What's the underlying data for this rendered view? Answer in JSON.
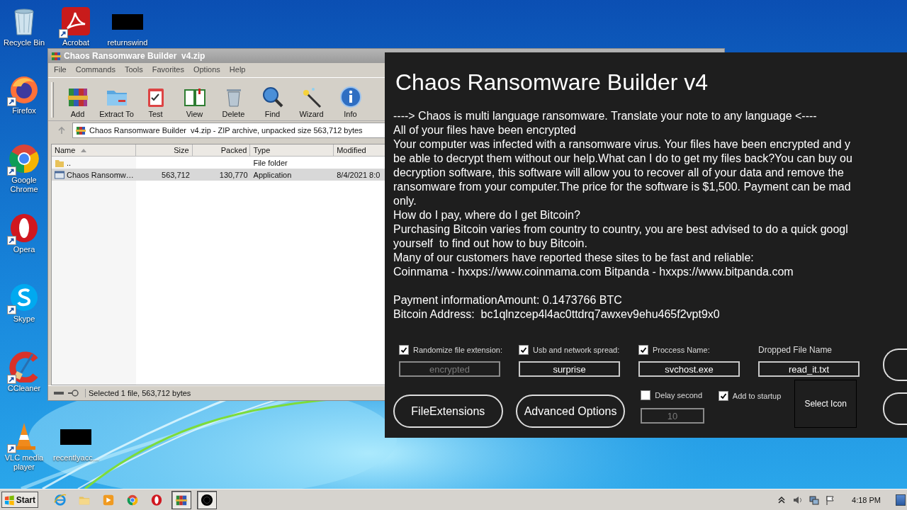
{
  "desktop": {
    "icons": [
      {
        "label": "Recycle Bin",
        "kind": "recycle",
        "shortcut": false
      },
      {
        "label": "Acrobat",
        "kind": "acrobat",
        "shortcut": true
      },
      {
        "label": "returnswind",
        "kind": "redacted",
        "shortcut": false
      },
      {
        "label": "Firefox",
        "kind": "firefox",
        "shortcut": true
      },
      {
        "label": "Google Chrome",
        "kind": "chrome",
        "shortcut": true
      },
      {
        "label": "Opera",
        "kind": "opera",
        "shortcut": true
      },
      {
        "label": "Skype",
        "kind": "skype",
        "shortcut": true
      },
      {
        "label": "CCleaner",
        "kind": "ccleaner",
        "shortcut": true
      },
      {
        "label": "VLC media player",
        "kind": "vlc",
        "shortcut": true
      },
      {
        "label": "recentlyacc...",
        "kind": "redacted",
        "shortcut": false
      }
    ]
  },
  "archive_window": {
    "title": "Chaos Ransomware Builder  v4.zip",
    "menu": [
      "File",
      "Commands",
      "Tools",
      "Favorites",
      "Options",
      "Help"
    ],
    "toolbar": [
      {
        "label": "Add",
        "kind": "add"
      },
      {
        "label": "Extract To",
        "kind": "extract"
      },
      {
        "label": "Test",
        "kind": "test"
      },
      {
        "label": "View",
        "kind": "view"
      },
      {
        "label": "Delete",
        "kind": "delete"
      },
      {
        "label": "Find",
        "kind": "find"
      },
      {
        "label": "Wizard",
        "kind": "wizard"
      },
      {
        "label": "Info",
        "kind": "info"
      }
    ],
    "path": "Chaos Ransomware Builder  v4.zip - ZIP archive, unpacked size 563,712 bytes",
    "columns": [
      {
        "label": "Name",
        "sorted": true
      },
      {
        "label": "Size",
        "sorted": false
      },
      {
        "label": "Packed",
        "sorted": false
      },
      {
        "label": "Type",
        "sorted": false
      },
      {
        "label": "Modified",
        "sorted": false
      }
    ],
    "rows": [
      {
        "kind": "folder",
        "name": "..",
        "type": "File folder",
        "selected": false
      },
      {
        "kind": "app",
        "name": "Chaos Ransomw…",
        "size": "563,712",
        "packed": "130,770",
        "type": "Application",
        "modified": "8/4/2021 8:0",
        "selected": true
      }
    ],
    "status": "Selected 1 file, 563,712 bytes"
  },
  "builder_window": {
    "title": "Chaos Ransomware Builder v4",
    "note_lines": [
      "----> Chaos is multi language ransomware. Translate your note to any language <----",
      "All of your files have been encrypted",
      "Your computer was infected with a ransomware virus. Your files have been encrypted and y",
      "be able to decrypt them without our help.What can I do to get my files back?You can buy ou",
      "decryption software, this software will allow you to recover all of your data and remove the",
      "ransomware from your computer.The price for the software is $1,500. Payment can be mad",
      "only.",
      "How do I pay, where do I get Bitcoin?",
      "Purchasing Bitcoin varies from country to country, you are best advised to do a quick googl",
      "yourself  to find out how to buy Bitcoin.",
      "Many of our customers have reported these sites to be fast and reliable:",
      "Coinmama - hxxps://www.coinmama.com Bitpanda - hxxps://www.bitpanda.com"
    ],
    "payment_lines": [
      "Payment informationAmount: 0.1473766 BTC",
      "Bitcoin Address:  bc1qlnzcep4l4ac0ttdrq7awxev9ehu465f2vpt9x0"
    ],
    "options": [
      {
        "kind": "checkbox",
        "label": "Randomize file extension:",
        "checked": true,
        "value": "encrypted",
        "disabled": true
      },
      {
        "kind": "checkbox",
        "label": "Usb and network spread:",
        "checked": true,
        "value": "surprise",
        "disabled": false
      },
      {
        "kind": "checkbox",
        "label": "Proccess Name:",
        "checked": true,
        "value": "svchost.exe",
        "disabled": false
      },
      {
        "kind": "label",
        "label": "Dropped File Name",
        "value": "read_it.txt",
        "disabled": false
      }
    ],
    "buttons": [
      "FileExtensions",
      "Advanced Options"
    ],
    "delay": {
      "label": "Delay second",
      "checked": false,
      "value": "10",
      "disabled": true
    },
    "startup": {
      "label": "Add to startup",
      "checked": true
    },
    "icon_button": "Select Icon"
  },
  "taskbar": {
    "start": "Start",
    "items": [
      {
        "kind": "ie",
        "active": false
      },
      {
        "kind": "explorer",
        "active": false
      },
      {
        "kind": "media",
        "active": false
      },
      {
        "kind": "chrome",
        "active": false
      },
      {
        "kind": "opera",
        "active": false
      },
      {
        "kind": "winrar",
        "active": true
      },
      {
        "kind": "app",
        "active": true
      }
    ],
    "clock": "4:18 PM"
  }
}
